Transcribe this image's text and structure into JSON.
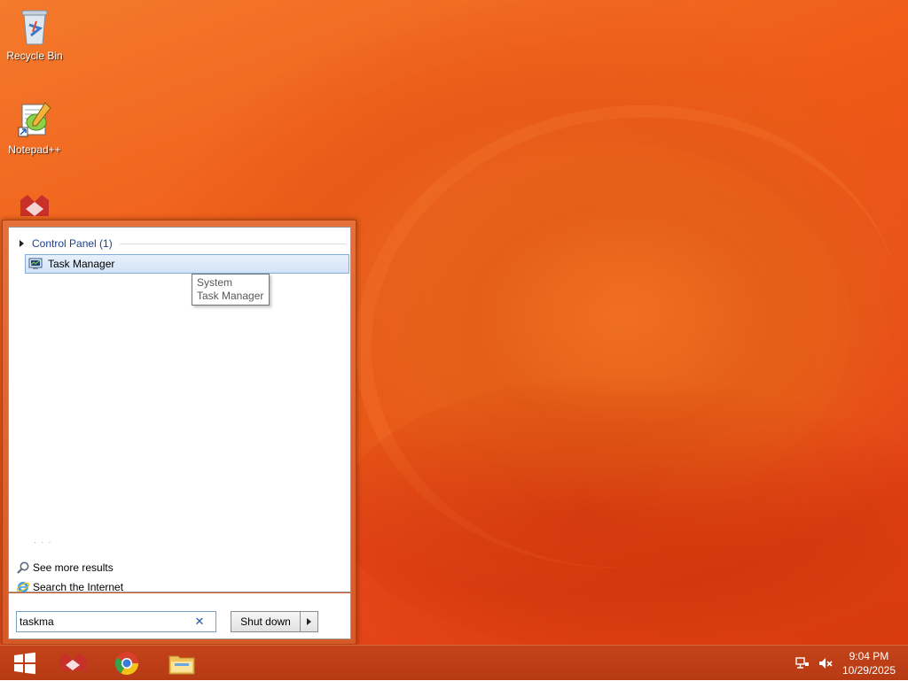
{
  "desktop": {
    "icons": [
      {
        "label": "Recycle Bin",
        "icon": "recycle-bin-icon"
      },
      {
        "label": "Notepad++",
        "icon": "notepad-plus-plus-icon"
      },
      {
        "label": "",
        "icon": "app-shortcut-icon"
      }
    ]
  },
  "start_menu": {
    "group_header": "Control Panel (1)",
    "result_item": "Task Manager",
    "tooltip": {
      "line1": "System",
      "line2": "Task Manager"
    },
    "more_results": "See more results",
    "search_internet": "Search the Internet",
    "search_value": "taskma",
    "shutdown_label": "Shut down"
  },
  "taskbar": {
    "pinned": [
      "start-icon",
      "app-shortcut-icon",
      "chrome-icon",
      "file-explorer-icon"
    ],
    "tray_icons": [
      "network-icon",
      "volume-muted-icon"
    ],
    "time": "9:04 PM",
    "date": "10/29/2025"
  },
  "colors": {
    "desktop_bg": "#ef5a16",
    "taskbar_bg": "#b63a14",
    "selection": "#d3e3f6",
    "link_blue": "#1e3f8a"
  }
}
